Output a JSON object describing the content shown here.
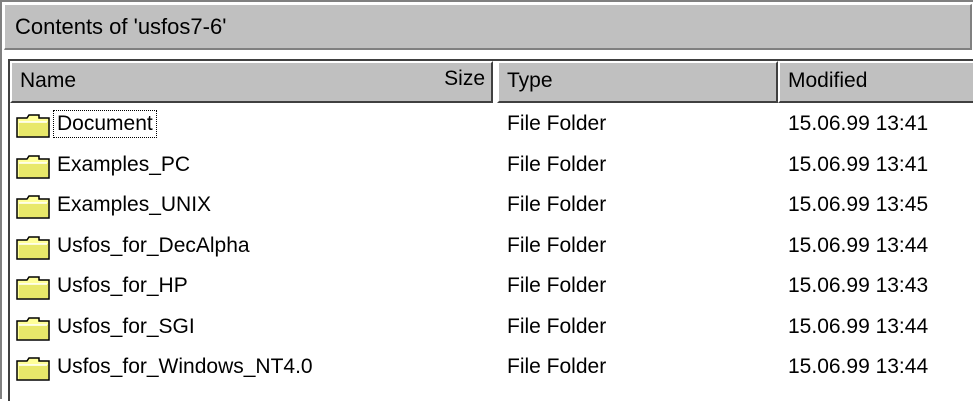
{
  "window": {
    "title": "Contents of 'usfos7-6'"
  },
  "columns": {
    "name": "Name",
    "size": "Size",
    "type": "Type",
    "modified": "Modified"
  },
  "items": [
    {
      "name": "Document",
      "type": "File Folder",
      "modified": "15.06.99 13:41",
      "icon": "folder-icon"
    },
    {
      "name": "Examples_PC",
      "type": "File Folder",
      "modified": "15.06.99 13:41",
      "icon": "folder-icon"
    },
    {
      "name": "Examples_UNIX",
      "type": "File Folder",
      "modified": "15.06.99 13:45",
      "icon": "folder-icon"
    },
    {
      "name": "Usfos_for_DecAlpha",
      "type": "File Folder",
      "modified": "15.06.99 13:44",
      "icon": "folder-icon"
    },
    {
      "name": "Usfos_for_HP",
      "type": "File Folder",
      "modified": "15.06.99 13:43",
      "icon": "folder-icon"
    },
    {
      "name": "Usfos_for_SGI",
      "type": "File Folder",
      "modified": "15.06.99 13:44",
      "icon": "folder-icon"
    },
    {
      "name": "Usfos_for_Windows_NT4.0",
      "type": "File Folder",
      "modified": "15.06.99 13:44",
      "icon": "folder-icon"
    }
  ],
  "colors": {
    "folder_fill": "#ffff99",
    "folder_shadow": "#c0c000",
    "chrome": "#c0c0c0"
  }
}
